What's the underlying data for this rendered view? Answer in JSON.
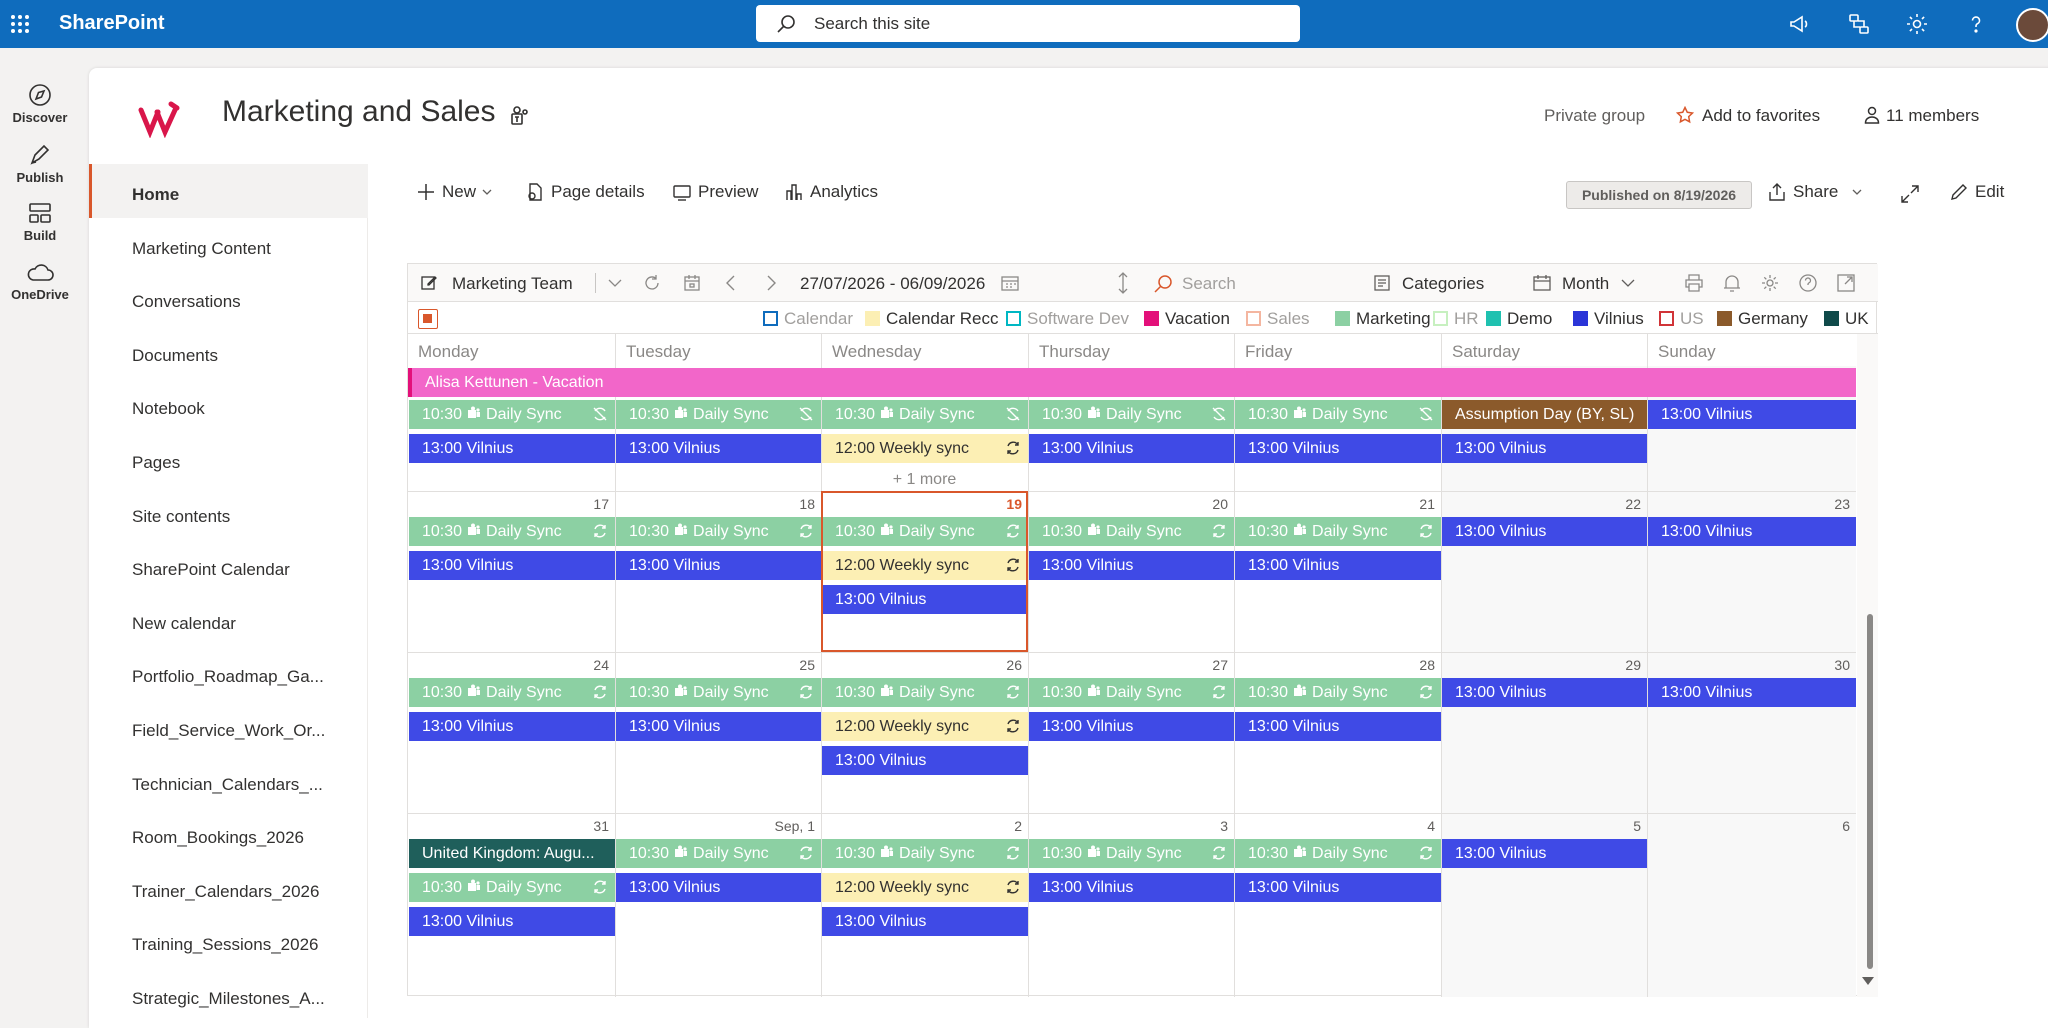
{
  "app": {
    "brand": "SharePoint",
    "search_placeholder": "Search this site"
  },
  "rail": [
    {
      "label": "Discover"
    },
    {
      "label": "Publish"
    },
    {
      "label": "Build"
    },
    {
      "label": "OneDrive"
    }
  ],
  "site": {
    "title": "Marketing and Sales",
    "privacy": "Private group",
    "favorite": "Add to favorites",
    "members": "11 members"
  },
  "nav": [
    "Home",
    "Marketing Content",
    "Conversations",
    "Documents",
    "Notebook",
    "Pages",
    "Site contents",
    "SharePoint Calendar",
    "New calendar",
    "Portfolio_Roadmap_Ga...",
    "Field_Service_Work_Or...",
    "Technician_Calendars_...",
    "Room_Bookings_2026",
    "Trainer_Calendars_2026",
    "Training_Sessions_2026",
    "Strategic_Milestones_A..."
  ],
  "cmd": {
    "new": "New",
    "page_details": "Page details",
    "preview": "Preview",
    "analytics": "Analytics",
    "published": "Published on 8/19/2026",
    "share": "Share",
    "edit": "Edit"
  },
  "calendar": {
    "view_name": "Marketing Team",
    "range": "27/07/2026 - 06/09/2026",
    "search": "Search",
    "categories": "Categories",
    "mode": "Month",
    "legend": [
      {
        "label": "Calendar",
        "color": "#0f6cbd",
        "filled": false
      },
      {
        "label": "Calendar Recc",
        "color": "#fcefb4",
        "filled": true
      },
      {
        "label": "Software Dev",
        "color": "#00b7c3",
        "filled": false
      },
      {
        "label": "Vacation",
        "color": "#e3107a",
        "filled": true
      },
      {
        "label": "Sales",
        "color": "#f4b6a0",
        "filled": false
      },
      {
        "label": "Marketing",
        "color": "#8cd0a3",
        "filled": true
      },
      {
        "label": "HR",
        "color": "#c7f0c0",
        "filled": false
      },
      {
        "label": "Demo",
        "color": "#1fc1b0",
        "filled": true
      },
      {
        "label": "Vilnius",
        "color": "#2b35d8",
        "filled": true
      },
      {
        "label": "US",
        "color": "#d13438",
        "filled": false
      },
      {
        "label": "Germany",
        "color": "#8b5a2b",
        "filled": true
      },
      {
        "label": "UK",
        "color": "#0f4a4a",
        "filled": true
      }
    ],
    "days": [
      "Monday",
      "Tuesday",
      "Wednesday",
      "Thursday",
      "Friday",
      "Saturday",
      "Sunday"
    ],
    "weeks": [
      {
        "nums": [
          "",
          "",
          "",
          "",
          "",
          "",
          ""
        ],
        "allday": [
          {
            "text": "Alisa Kettunen - Vacation",
            "from": 0,
            "span": 7,
            "style": "pink"
          }
        ],
        "cells": [
          [
            {
              "t": "10:30",
              "s": "Daily Sync",
              "c": "green",
              "r": "x"
            },
            {
              "t": "13:00",
              "s": "Vilnius",
              "c": "blue"
            }
          ],
          [
            {
              "t": "10:30",
              "s": "Daily Sync",
              "c": "green",
              "r": "x"
            },
            {
              "t": "13:00",
              "s": "Vilnius",
              "c": "blue"
            }
          ],
          [
            {
              "t": "10:30",
              "s": "Daily Sync",
              "c": "green",
              "r": "x"
            },
            {
              "t": "12:00",
              "s": "Weekly sync",
              "c": "yellow",
              "r": "o"
            }
          ],
          [
            {
              "t": "10:30",
              "s": "Daily Sync",
              "c": "green",
              "r": "x"
            },
            {
              "t": "13:00",
              "s": "Vilnius",
              "c": "blue"
            }
          ],
          [
            {
              "t": "10:30",
              "s": "Daily Sync",
              "c": "green",
              "r": "x"
            },
            {
              "t": "13:00",
              "s": "Vilnius",
              "c": "blue"
            }
          ],
          [
            {
              "t": "",
              "s": "Assumption Day (BY, SL)",
              "c": "brown"
            },
            {
              "t": "13:00",
              "s": "Vilnius",
              "c": "blue"
            }
          ],
          [
            {
              "t": "13:00",
              "s": "Vilnius",
              "c": "blue"
            }
          ]
        ],
        "more": {
          "col": 2,
          "text": "+ 1 more"
        }
      },
      {
        "nums": [
          "17",
          "18",
          "19",
          "20",
          "21",
          "22",
          "23"
        ],
        "allday": [],
        "cells": [
          [
            {
              "t": "10:30",
              "s": "Daily Sync",
              "c": "green",
              "r": "o"
            },
            {
              "t": "13:00",
              "s": "Vilnius",
              "c": "blue"
            }
          ],
          [
            {
              "t": "10:30",
              "s": "Daily Sync",
              "c": "green",
              "r": "o"
            },
            {
              "t": "13:00",
              "s": "Vilnius",
              "c": "blue"
            }
          ],
          [
            {
              "t": "10:30",
              "s": "Daily Sync",
              "c": "green",
              "r": "o"
            },
            {
              "t": "12:00",
              "s": "Weekly sync",
              "c": "yellow",
              "r": "o"
            },
            {
              "t": "13:00",
              "s": "Vilnius",
              "c": "blue"
            }
          ],
          [
            {
              "t": "10:30",
              "s": "Daily Sync",
              "c": "green",
              "r": "o"
            },
            {
              "t": "13:00",
              "s": "Vilnius",
              "c": "blue"
            }
          ],
          [
            {
              "t": "10:30",
              "s": "Daily Sync",
              "c": "green",
              "r": "o"
            },
            {
              "t": "13:00",
              "s": "Vilnius",
              "c": "blue"
            }
          ],
          [
            {
              "t": "13:00",
              "s": "Vilnius",
              "c": "blue"
            }
          ],
          [
            {
              "t": "13:00",
              "s": "Vilnius",
              "c": "blue"
            }
          ]
        ]
      },
      {
        "nums": [
          "24",
          "25",
          "26",
          "27",
          "28",
          "29",
          "30"
        ],
        "allday": [],
        "cells": [
          [
            {
              "t": "10:30",
              "s": "Daily Sync",
              "c": "green",
              "r": "o"
            },
            {
              "t": "13:00",
              "s": "Vilnius",
              "c": "blue"
            }
          ],
          [
            {
              "t": "10:30",
              "s": "Daily Sync",
              "c": "green",
              "r": "o"
            },
            {
              "t": "13:00",
              "s": "Vilnius",
              "c": "blue"
            }
          ],
          [
            {
              "t": "10:30",
              "s": "Daily Sync",
              "c": "green",
              "r": "o"
            },
            {
              "t": "12:00",
              "s": "Weekly sync",
              "c": "yellow",
              "r": "o"
            },
            {
              "t": "13:00",
              "s": "Vilnius",
              "c": "blue"
            }
          ],
          [
            {
              "t": "10:30",
              "s": "Daily Sync",
              "c": "green",
              "r": "o"
            },
            {
              "t": "13:00",
              "s": "Vilnius",
              "c": "blue"
            }
          ],
          [
            {
              "t": "10:30",
              "s": "Daily Sync",
              "c": "green",
              "r": "o"
            },
            {
              "t": "13:00",
              "s": "Vilnius",
              "c": "blue"
            }
          ],
          [
            {
              "t": "13:00",
              "s": "Vilnius",
              "c": "blue"
            }
          ],
          [
            {
              "t": "13:00",
              "s": "Vilnius",
              "c": "blue"
            }
          ]
        ]
      },
      {
        "nums": [
          "31",
          "Sep, 1",
          "2",
          "3",
          "4",
          "5",
          "6"
        ],
        "allday": [],
        "cells": [
          [
            {
              "t": "",
              "s": "United Kingdom: Augu...",
              "c": "dark"
            },
            {
              "t": "10:30",
              "s": "Daily Sync",
              "c": "green",
              "r": "o"
            },
            {
              "t": "13:00",
              "s": "Vilnius",
              "c": "blue"
            }
          ],
          [
            {
              "t": "10:30",
              "s": "Daily Sync",
              "c": "green",
              "r": "o"
            },
            {
              "t": "13:00",
              "s": "Vilnius",
              "c": "blue"
            }
          ],
          [
            {
              "t": "10:30",
              "s": "Daily Sync",
              "c": "green",
              "r": "o"
            },
            {
              "t": "12:00",
              "s": "Weekly sync",
              "c": "yellow",
              "r": "o"
            },
            {
              "t": "13:00",
              "s": "Vilnius",
              "c": "blue"
            }
          ],
          [
            {
              "t": "10:30",
              "s": "Daily Sync",
              "c": "green",
              "r": "o"
            },
            {
              "t": "13:00",
              "s": "Vilnius",
              "c": "blue"
            }
          ],
          [
            {
              "t": "10:30",
              "s": "Daily Sync",
              "c": "green",
              "r": "o"
            },
            {
              "t": "13:00",
              "s": "Vilnius",
              "c": "blue"
            }
          ],
          [
            {
              "t": "13:00",
              "s": "Vilnius",
              "c": "blue"
            }
          ],
          []
        ]
      }
    ],
    "today": {
      "week": 1,
      "col": 2
    }
  }
}
